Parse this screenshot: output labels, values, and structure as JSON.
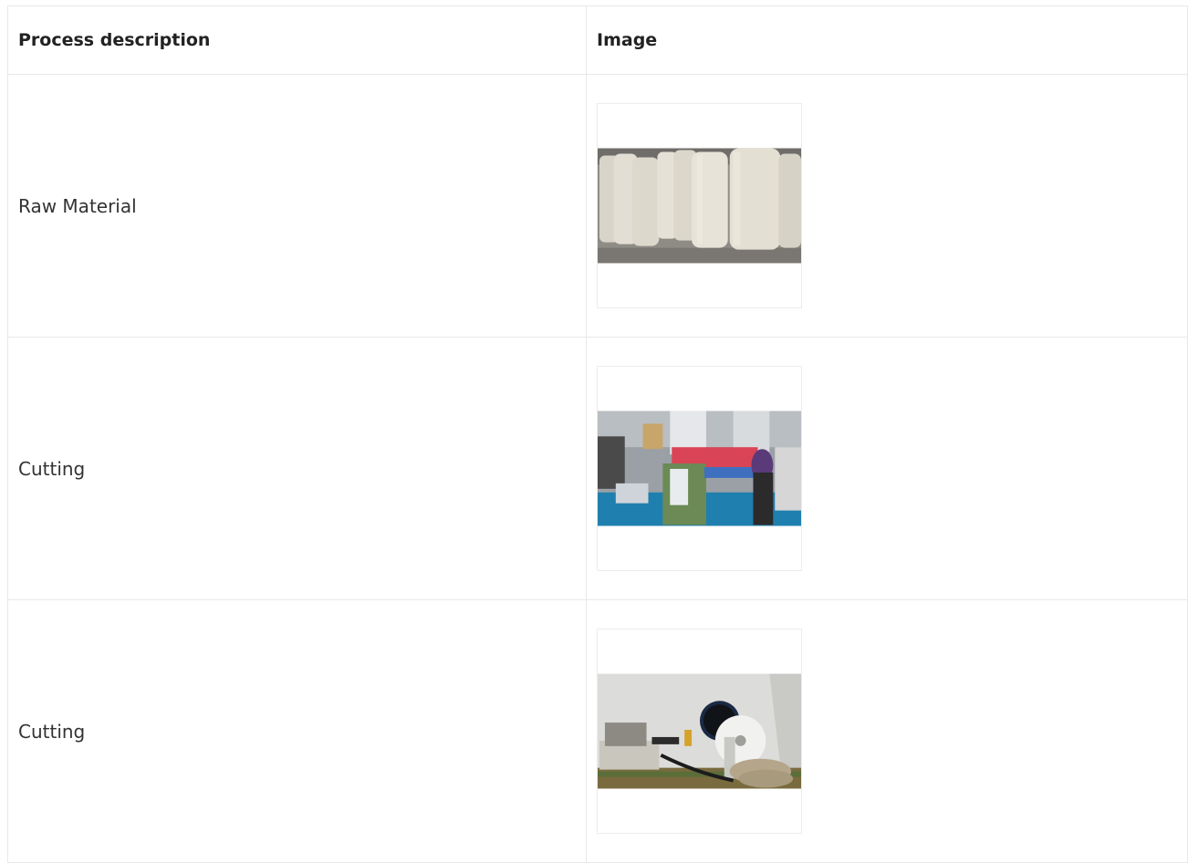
{
  "table": {
    "headers": {
      "process": "Process description",
      "image": "Image"
    },
    "rows": [
      {
        "process": "Raw Material",
        "image_subject": "fabric-rolls-photo"
      },
      {
        "process": "Cutting",
        "image_subject": "cutting-machine-photo"
      },
      {
        "process": "Cutting",
        "image_subject": "tape-reel-machine-photo"
      }
    ]
  },
  "colors": {
    "border": "#e8e8e8",
    "text": "#333333",
    "header_text": "#222222"
  }
}
